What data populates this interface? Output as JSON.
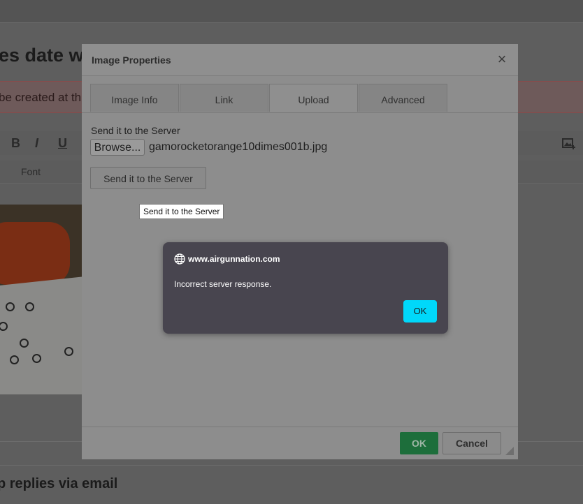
{
  "background": {
    "page_title_fragment": "es date wi",
    "alert_fragment": "be created at th",
    "font_dropdown": "Font",
    "footer_fragment": "p replies via email",
    "toolbar": {
      "bold": "B",
      "italic": "I",
      "underline": "U"
    }
  },
  "dialog": {
    "title": "Image Properties",
    "close_glyph": "×",
    "tabs": [
      "Image Info",
      "Link",
      "Upload",
      "Advanced"
    ],
    "active_tab": "Upload",
    "upload": {
      "label": "Send it to the Server",
      "browse_label": "Browse...",
      "filename": "gamorocketorange10dimes001b.jpg",
      "send_button": "Send it to the Server",
      "tooltip": "Send it to the Server"
    },
    "footer": {
      "ok_label": "OK",
      "cancel_label": "Cancel"
    }
  },
  "browser_alert": {
    "host": "www.airgunnation.com",
    "message": "Incorrect server response.",
    "ok_label": "OK"
  },
  "colors": {
    "ok_green": "#1d6e3b",
    "alert_bg": "#48454f",
    "alert_button": "#00d8fa"
  }
}
